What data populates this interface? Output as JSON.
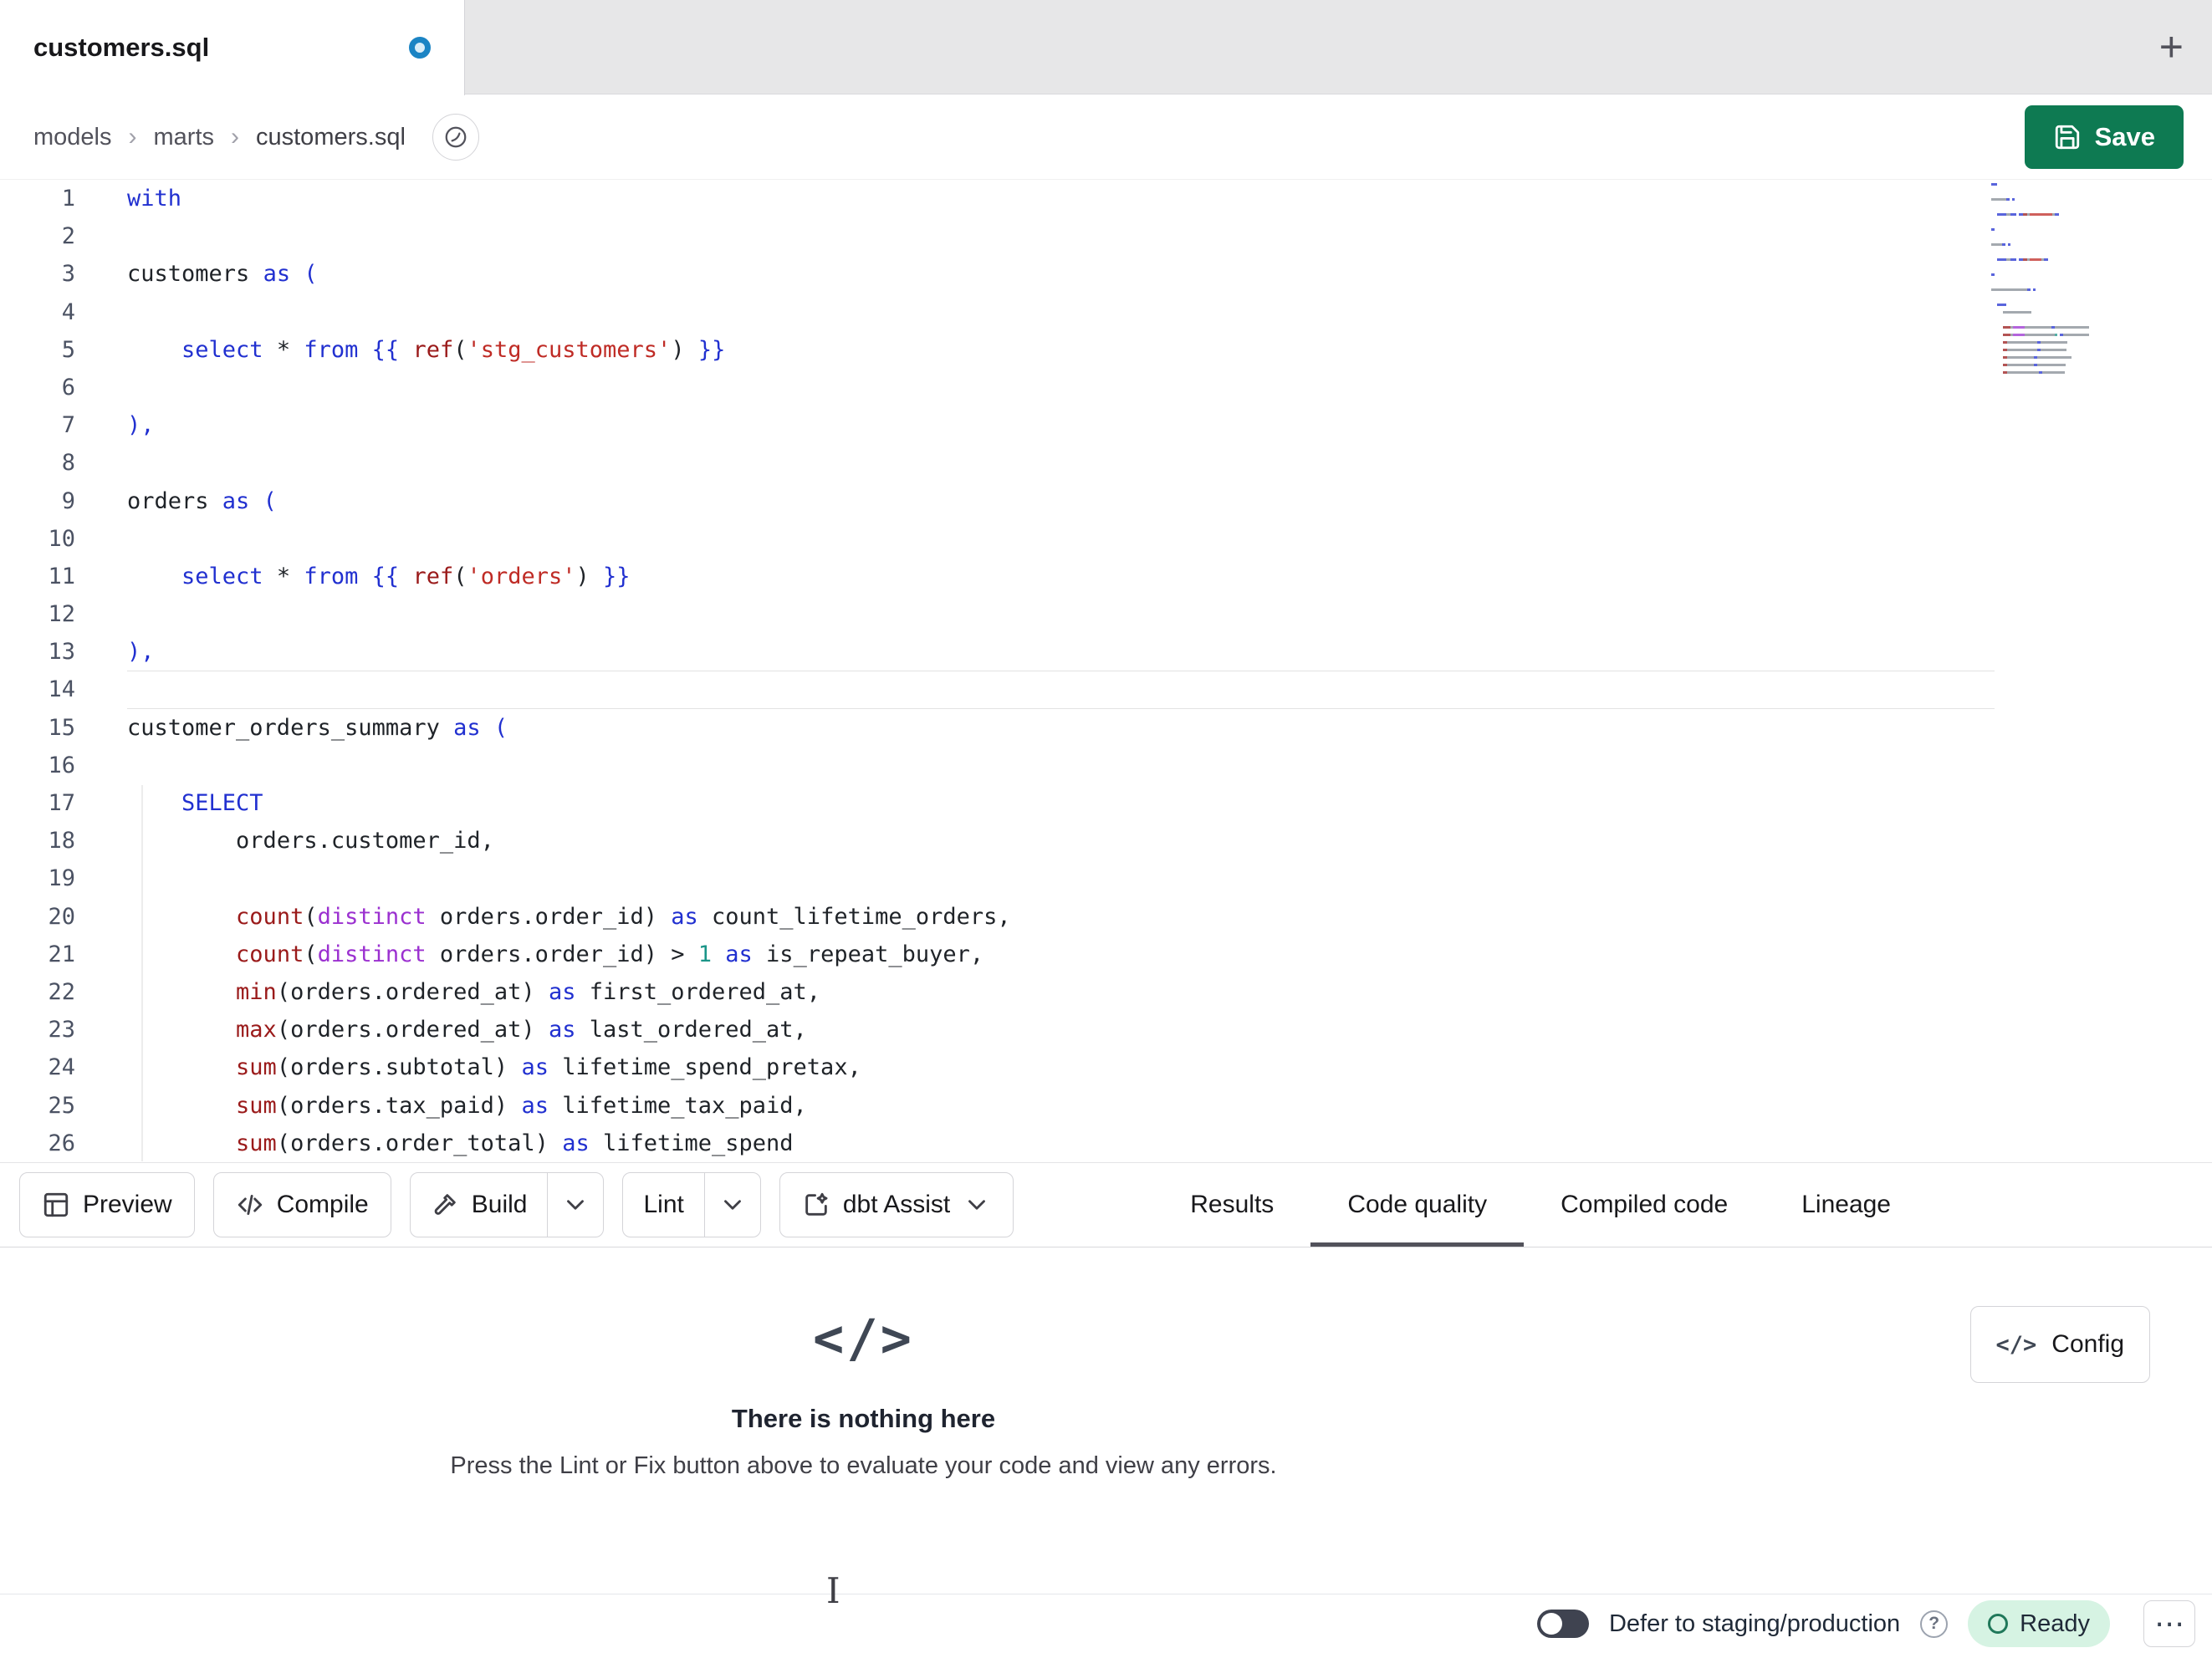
{
  "colors": {
    "accent_green": "#0E7A52",
    "keyword_blue": "#2130D0",
    "function_red": "#9A1A1A",
    "string_red": "#BF2B25",
    "distinct_purple": "#9B30D0",
    "number_teal": "#1B9588",
    "ready_badge_bg": "#D6F3E3",
    "unsaved_dot_blue": "#1B84C4",
    "active_tab_underline": "#52525B"
  },
  "tabbar": {
    "tab_title": "customers.sql",
    "new_tab_label": "+"
  },
  "breadcrumb": {
    "items": [
      "models",
      "marts",
      "customers.sql"
    ],
    "separator": "›"
  },
  "header": {
    "save_label": "Save"
  },
  "editor": {
    "active_line": 14,
    "lines": [
      {
        "n": 1,
        "t": [
          [
            "kw",
            "with"
          ]
        ]
      },
      {
        "n": 2,
        "t": []
      },
      {
        "n": 3,
        "t": [
          [
            "pl",
            "customers "
          ],
          [
            "kw",
            "as"
          ],
          [
            "pl",
            " "
          ],
          [
            "br",
            "("
          ]
        ]
      },
      {
        "n": 4,
        "t": []
      },
      {
        "n": 5,
        "t": [
          [
            "pl",
            "    "
          ],
          [
            "kw",
            "select"
          ],
          [
            "pl",
            " * "
          ],
          [
            "kw",
            "from"
          ],
          [
            "pl",
            " "
          ],
          [
            "br",
            "{{ "
          ],
          [
            "fn",
            "ref"
          ],
          [
            "pl",
            "("
          ],
          [
            "str",
            "'stg_customers'"
          ],
          [
            "pl",
            ")"
          ],
          [
            "br",
            " }}"
          ]
        ]
      },
      {
        "n": 6,
        "t": []
      },
      {
        "n": 7,
        "t": [
          [
            "br",
            "),"
          ]
        ]
      },
      {
        "n": 8,
        "t": []
      },
      {
        "n": 9,
        "t": [
          [
            "pl",
            "orders "
          ],
          [
            "kw",
            "as"
          ],
          [
            "pl",
            " "
          ],
          [
            "br",
            "("
          ]
        ]
      },
      {
        "n": 10,
        "t": []
      },
      {
        "n": 11,
        "t": [
          [
            "pl",
            "    "
          ],
          [
            "kw",
            "select"
          ],
          [
            "pl",
            " * "
          ],
          [
            "kw",
            "from"
          ],
          [
            "pl",
            " "
          ],
          [
            "br",
            "{{ "
          ],
          [
            "fn",
            "ref"
          ],
          [
            "pl",
            "("
          ],
          [
            "str",
            "'orders'"
          ],
          [
            "pl",
            ")"
          ],
          [
            "br",
            " }}"
          ]
        ]
      },
      {
        "n": 12,
        "t": []
      },
      {
        "n": 13,
        "t": [
          [
            "br",
            "),"
          ]
        ]
      },
      {
        "n": 14,
        "t": []
      },
      {
        "n": 15,
        "t": [
          [
            "pl",
            "customer_orders_summary "
          ],
          [
            "kw",
            "as"
          ],
          [
            "pl",
            " "
          ],
          [
            "br",
            "("
          ]
        ]
      },
      {
        "n": 16,
        "t": []
      },
      {
        "n": 17,
        "t": [
          [
            "pl",
            "    "
          ],
          [
            "kw",
            "SELECT"
          ]
        ]
      },
      {
        "n": 18,
        "t": [
          [
            "pl",
            "        "
          ],
          [
            "pl",
            "orders.customer_id,"
          ]
        ]
      },
      {
        "n": 19,
        "t": []
      },
      {
        "n": 20,
        "t": [
          [
            "pl",
            "        "
          ],
          [
            "fn",
            "count"
          ],
          [
            "pl",
            "("
          ],
          [
            "pur",
            "distinct"
          ],
          [
            "pl",
            " orders.order_id) "
          ],
          [
            "kw",
            "as"
          ],
          [
            "pl",
            " count_lifetime_orders,"
          ]
        ]
      },
      {
        "n": 21,
        "t": [
          [
            "pl",
            "        "
          ],
          [
            "fn",
            "count"
          ],
          [
            "pl",
            "("
          ],
          [
            "pur",
            "distinct"
          ],
          [
            "pl",
            " orders.order_id) > "
          ],
          [
            "num",
            "1"
          ],
          [
            "pl",
            " "
          ],
          [
            "kw",
            "as"
          ],
          [
            "pl",
            " is_repeat_buyer,"
          ]
        ]
      },
      {
        "n": 22,
        "t": [
          [
            "pl",
            "        "
          ],
          [
            "fn",
            "min"
          ],
          [
            "pl",
            "(orders.ordered_at) "
          ],
          [
            "kw",
            "as"
          ],
          [
            "pl",
            " first_ordered_at,"
          ]
        ]
      },
      {
        "n": 23,
        "t": [
          [
            "pl",
            "        "
          ],
          [
            "fn",
            "max"
          ],
          [
            "pl",
            "(orders.ordered_at) "
          ],
          [
            "kw",
            "as"
          ],
          [
            "pl",
            " last_ordered_at,"
          ]
        ]
      },
      {
        "n": 24,
        "t": [
          [
            "pl",
            "        "
          ],
          [
            "fn",
            "sum"
          ],
          [
            "pl",
            "(orders.subtotal) "
          ],
          [
            "kw",
            "as"
          ],
          [
            "pl",
            " lifetime_spend_pretax,"
          ]
        ]
      },
      {
        "n": 25,
        "t": [
          [
            "pl",
            "        "
          ],
          [
            "fn",
            "sum"
          ],
          [
            "pl",
            "(orders.tax_paid) "
          ],
          [
            "kw",
            "as"
          ],
          [
            "pl",
            " lifetime_tax_paid,"
          ]
        ]
      },
      {
        "n": 26,
        "t": [
          [
            "pl",
            "        "
          ],
          [
            "fn",
            "sum"
          ],
          [
            "pl",
            "(orders.order_total) "
          ],
          [
            "kw",
            "as"
          ],
          [
            "pl",
            " lifetime_spend"
          ]
        ]
      }
    ]
  },
  "toolbar": {
    "preview_label": "Preview",
    "compile_label": "Compile",
    "build_label": "Build",
    "lint_label": "Lint",
    "assist_label": "dbt Assist"
  },
  "result_tabs": [
    {
      "label": "Results"
    },
    {
      "label": "Code quality"
    },
    {
      "label": "Compiled code"
    },
    {
      "label": "Lineage"
    }
  ],
  "empty_state": {
    "icon_glyph": "</>",
    "title": "There is nothing here",
    "subtitle": "Press the Lint or Fix button above to evaluate your code and view any errors.",
    "config_label": "Config",
    "config_glyph": "</>"
  },
  "statusbar": {
    "defer_label": "Defer to staging/production",
    "help_glyph": "?",
    "ready_label": "Ready",
    "menu_glyph": "⋯"
  }
}
